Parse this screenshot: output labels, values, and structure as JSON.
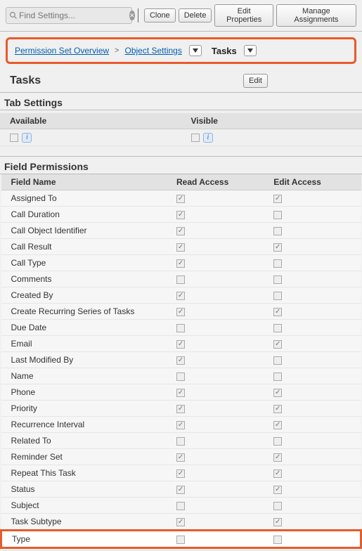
{
  "toolbar": {
    "search_placeholder": "Find Settings...",
    "clone": "Clone",
    "delete": "Delete",
    "edit_props": "Edit Properties",
    "manage_assign": "Manage Assignments"
  },
  "breadcrumb": {
    "overview": "Permission Set Overview",
    "object_settings": "Object Settings",
    "current": "Tasks"
  },
  "header": {
    "title": "Tasks",
    "edit_label": "Edit"
  },
  "tab_settings": {
    "title": "Tab Settings",
    "col_available": "Available",
    "col_visible": "Visible",
    "info": "i"
  },
  "field_perms": {
    "title": "Field Permissions",
    "col_field": "Field Name",
    "col_read": "Read Access",
    "col_edit": "Edit Access",
    "rows": [
      {
        "name": "Assigned To",
        "read": true,
        "edit": true
      },
      {
        "name": "Call Duration",
        "read": true,
        "edit": false
      },
      {
        "name": "Call Object Identifier",
        "read": true,
        "edit": false
      },
      {
        "name": "Call Result",
        "read": true,
        "edit": true
      },
      {
        "name": "Call Type",
        "read": true,
        "edit": false
      },
      {
        "name": "Comments",
        "read": false,
        "edit": false
      },
      {
        "name": "Created By",
        "read": true,
        "edit": false
      },
      {
        "name": "Create Recurring Series of Tasks",
        "read": true,
        "edit": true
      },
      {
        "name": "Due Date",
        "read": false,
        "edit": false
      },
      {
        "name": "Email",
        "read": true,
        "edit": true
      },
      {
        "name": "Last Modified By",
        "read": true,
        "edit": false
      },
      {
        "name": "Name",
        "read": false,
        "edit": false
      },
      {
        "name": "Phone",
        "read": true,
        "edit": true
      },
      {
        "name": "Priority",
        "read": true,
        "edit": true
      },
      {
        "name": "Recurrence Interval",
        "read": true,
        "edit": true
      },
      {
        "name": "Related To",
        "read": false,
        "edit": false
      },
      {
        "name": "Reminder Set",
        "read": true,
        "edit": true
      },
      {
        "name": "Repeat This Task",
        "read": true,
        "edit": true
      },
      {
        "name": "Status",
        "read": true,
        "edit": true
      },
      {
        "name": "Subject",
        "read": false,
        "edit": false
      },
      {
        "name": "Task Subtype",
        "read": true,
        "edit": true
      },
      {
        "name": "Type",
        "read": false,
        "edit": false,
        "highlight": true
      }
    ],
    "truncated_label": "…"
  }
}
